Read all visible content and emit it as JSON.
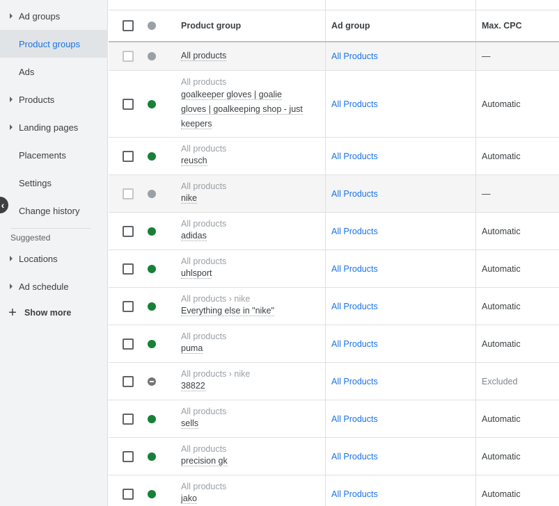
{
  "sidebar": {
    "items": [
      {
        "label": "Ad groups",
        "caret": true,
        "active": false
      },
      {
        "label": "Product groups",
        "caret": false,
        "active": true
      },
      {
        "label": "Ads",
        "caret": false,
        "active": false
      },
      {
        "label": "Products",
        "caret": true,
        "active": false
      },
      {
        "label": "Landing pages",
        "caret": true,
        "active": false
      },
      {
        "label": "Placements",
        "caret": false,
        "active": false
      },
      {
        "label": "Settings",
        "caret": false,
        "active": false
      },
      {
        "label": "Change history",
        "caret": false,
        "active": false
      }
    ],
    "suggested_label": "Suggested",
    "suggested_items": [
      {
        "label": "Locations",
        "caret": true
      },
      {
        "label": "Ad schedule",
        "caret": true
      }
    ],
    "show_more_label": "Show more",
    "collapse_icon": "‹"
  },
  "table": {
    "headers": {
      "product_group": "Product group",
      "ad_group": "Ad group",
      "max_cpc": "Max. CPC"
    },
    "rows": [
      {
        "path": "",
        "name": "All products",
        "ad_group": "All Products",
        "max_cpc": "—",
        "status": "grey",
        "disabled": true
      },
      {
        "path": "All products",
        "name": "goalkeeper gloves | goalie gloves | goalkeeping shop - just keepers",
        "name_lines": [
          "goalkeeper gloves | goalie",
          "gloves | goalkeeping shop - just",
          "keepers"
        ],
        "ad_group": "All Products",
        "max_cpc": "Automatic",
        "status": "green",
        "disabled": false
      },
      {
        "path": "All products",
        "name": "reusch",
        "ad_group": "All Products",
        "max_cpc": "Automatic",
        "status": "green",
        "disabled": false
      },
      {
        "path": "All products",
        "name": "nike",
        "ad_group": "All Products",
        "max_cpc": "—",
        "status": "grey",
        "disabled": true
      },
      {
        "path": "All products",
        "name": "adidas",
        "ad_group": "All Products",
        "max_cpc": "Automatic",
        "status": "green",
        "disabled": false
      },
      {
        "path": "All products",
        "name": "uhlsport",
        "ad_group": "All Products",
        "max_cpc": "Automatic",
        "status": "green",
        "disabled": false
      },
      {
        "path": "All products › nike",
        "name": "Everything else in \"nike\"",
        "ad_group": "All Products",
        "max_cpc": "Automatic",
        "status": "green",
        "disabled": false
      },
      {
        "path": "All products",
        "name": "puma",
        "ad_group": "All Products",
        "max_cpc": "Automatic",
        "status": "green",
        "disabled": false
      },
      {
        "path": "All products › nike",
        "name": "38822",
        "ad_group": "All Products",
        "max_cpc": "Excluded",
        "status": "excluded",
        "disabled": false
      },
      {
        "path": "All products",
        "name": "sells",
        "ad_group": "All Products",
        "max_cpc": "Automatic",
        "status": "green",
        "disabled": false
      },
      {
        "path": "All products",
        "name": "precision gk",
        "ad_group": "All Products",
        "max_cpc": "Automatic",
        "status": "green",
        "disabled": false
      },
      {
        "path": "All products",
        "name": "jako",
        "ad_group": "All Products",
        "max_cpc": "Automatic",
        "status": "green",
        "disabled": false
      }
    ]
  },
  "colors": {
    "link": "#1a73e8",
    "status_enabled": "#188038",
    "status_paused": "#9aa0a6"
  }
}
